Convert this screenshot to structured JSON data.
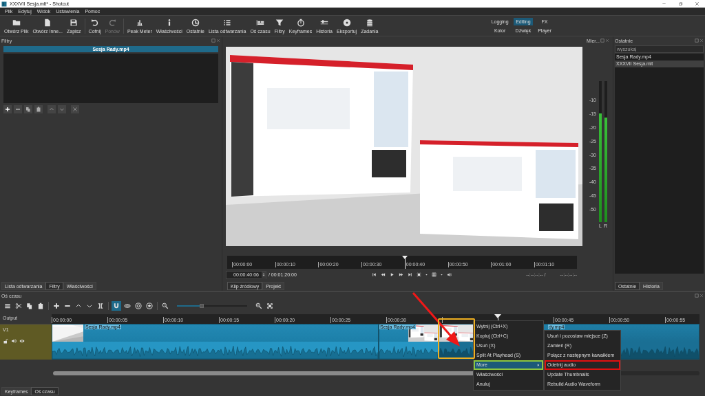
{
  "window": {
    "title": "XXXVII Sesja.mlt* - Shotcut"
  },
  "menu": [
    "Plik",
    "Edytuj",
    "Widok",
    "Ustawienia",
    "Pomoc"
  ],
  "toolbar": [
    {
      "label": "Otwórz Plik",
      "disabled": false
    },
    {
      "label": "Otwórz Inne...",
      "disabled": false
    },
    {
      "label": "Zapisz",
      "disabled": false
    },
    {
      "label": "Cofnij",
      "disabled": false
    },
    {
      "label": "Ponów",
      "disabled": true
    },
    {
      "label": "Peak Meter",
      "disabled": false
    },
    {
      "label": "Właściwości",
      "disabled": false
    },
    {
      "label": "Ostatnie",
      "disabled": false
    },
    {
      "label": "Lista odtwarzania",
      "disabled": false
    },
    {
      "label": "Oś czasu",
      "disabled": false
    },
    {
      "label": "Filtry",
      "disabled": false
    },
    {
      "label": "Keyframes",
      "disabled": false
    },
    {
      "label": "Historia",
      "disabled": false
    },
    {
      "label": "Eksportuj",
      "disabled": false
    },
    {
      "label": "Zadania",
      "disabled": false
    }
  ],
  "layouts": [
    {
      "label": "Logging",
      "selected": false
    },
    {
      "label": "Editing",
      "selected": true
    },
    {
      "label": "FX",
      "selected": false
    },
    {
      "label": "Kolor",
      "selected": false
    },
    {
      "label": "Dźwięk",
      "selected": false
    },
    {
      "label": "Player",
      "selected": false
    }
  ],
  "filters_panel": {
    "title": "Filtry",
    "clip": "Sesja Rady.mp4",
    "tabs": [
      {
        "label": "Lista odtwarzania",
        "selected": false
      },
      {
        "label": "Filtry",
        "selected": true
      },
      {
        "label": "Właściwości",
        "selected": false
      }
    ]
  },
  "player": {
    "picture": {
      "kind": "picture"
    },
    "ruler": [
      "00:00:00",
      "00:00:10",
      "00:00:20",
      "00:00:30",
      "00:00:40",
      "00:00:50",
      "00:01:00",
      "00:01:10"
    ],
    "playhead": {
      "level": 0.5
    },
    "timecode": "00:00:40:06",
    "duration": "/ 00:01:20:00",
    "in_point": "--:--:--:-- /",
    "out_point": "--:--:--:--",
    "tabs": [
      {
        "label": "Klip źródłowy",
        "selected": true
      },
      {
        "label": "Projekt",
        "selected": false
      }
    ]
  },
  "meter": {
    "title": "Mier...",
    "scale": [
      "-10",
      "-15",
      "-20",
      "-25",
      "-30",
      "-35",
      "-40",
      "-45",
      "-50"
    ],
    "channels": [
      {
        "label": "L",
        "level": 0.77
      },
      {
        "label": "R",
        "level": 0.74
      }
    ]
  },
  "recent_panel": {
    "title": "Ostatnie",
    "search": {
      "placeholder": "wyszukaj"
    },
    "items": [
      {
        "label": "Sesja Rady.mp4",
        "selected": false
      },
      {
        "label": "XXXVII Sesja.mlt",
        "selected": true
      }
    ],
    "tabs": [
      {
        "label": "Ostatnie",
        "selected": true
      },
      {
        "label": "Historia",
        "selected": false
      }
    ]
  },
  "timeline": {
    "title": "Oś czasu",
    "toolbar": [
      {
        "selected": false
      },
      {
        "selected": false
      },
      {
        "selected": false
      },
      {
        "selected": false
      },
      {
        "selected": false
      },
      {
        "selected": false
      },
      {
        "selected": false
      },
      {
        "selected": false
      },
      {
        "selected": false
      },
      {
        "selected": true
      },
      {
        "selected": false
      },
      {
        "selected": false
      },
      {
        "selected": false
      },
      {
        "selected": false
      },
      {
        "selected": false
      },
      {
        "selected": false
      }
    ],
    "zoom_slider": {
      "level": 0.35
    },
    "output_label": "Output",
    "ruler": [
      "00:00:00",
      "00:00:05",
      "00:00:10",
      "00:00:15",
      "00:00:20",
      "00:00:25",
      "00:00:30",
      "00:00:45",
      "00:00:50",
      "00:00:55"
    ],
    "playhead": {
      "level": 0.689
    },
    "tracks": [
      {
        "name": "V1",
        "clips": [
          {
            "label": "Sesja Rady.mp4",
            "selected": false
          },
          {
            "label": "Sesja Rady.mp4",
            "selected": false
          },
          {
            "label": "dy.mp4",
            "selected": true
          }
        ]
      }
    ],
    "tabs": [
      {
        "label": "Keyframes",
        "selected": false
      },
      {
        "label": "Oś czasu",
        "selected": true
      }
    ]
  },
  "context_menu": {
    "items": [
      {
        "label": "Wytnij (Ctrl+X)",
        "selected": false,
        "outlined": false,
        "submenu": false
      },
      {
        "label": "Kopiuj (Ctrl+C)",
        "selected": false,
        "outlined": false,
        "submenu": false
      },
      {
        "label": "Usuń (X)",
        "selected": false,
        "outlined": false,
        "submenu": false
      },
      {
        "label": "Split At Playhead (S)",
        "selected": false,
        "outlined": false,
        "submenu": false
      },
      {
        "label": "More",
        "selected": true,
        "outlined": true,
        "submenu": true
      },
      {
        "label": "Właściwości",
        "selected": false,
        "outlined": false,
        "submenu": false
      },
      {
        "label": "Anuluj",
        "selected": false,
        "outlined": false,
        "submenu": false
      }
    ]
  },
  "submenu": {
    "items": [
      {
        "label": "Usuń i pozostaw miejsce (Z)",
        "outlined": false
      },
      {
        "label": "Zamień (R)",
        "outlined": false
      },
      {
        "label": "Połącz z następnym kawałkiem",
        "outlined": false
      },
      {
        "label": "Odetnij audio",
        "outlined": true
      },
      {
        "label": "Update Thumbnails",
        "outlined": false
      },
      {
        "label": "Rebuild Audio Waveform",
        "outlined": false
      }
    ]
  },
  "annotations": [
    {
      "kind": "arrow"
    },
    {
      "kind": "frame"
    }
  ]
}
